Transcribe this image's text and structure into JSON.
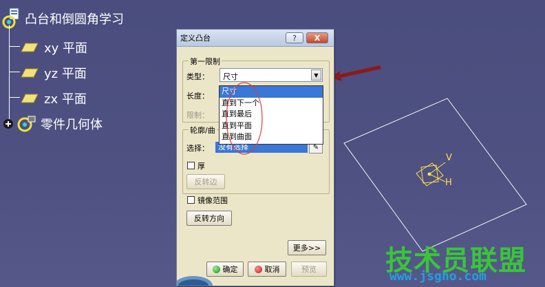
{
  "tree": {
    "root": {
      "label": "凸台和倒圆角学习",
      "icon": "part-icon"
    },
    "children": [
      {
        "label": "xy 平面",
        "icon": "plane-icon"
      },
      {
        "label": "yz 平面",
        "icon": "plane-icon"
      },
      {
        "label": "zx 平面",
        "icon": "plane-icon"
      },
      {
        "label": "零件几何体",
        "icon": "body-icon"
      }
    ]
  },
  "dialog": {
    "title": "定义凸台",
    "help_label": "?",
    "close_label": "X",
    "first_limit": {
      "group_title": "第一限制",
      "type_label": "类型：",
      "type_value": "尺寸",
      "length_label": "长度：",
      "limit_label": "限制："
    },
    "dropdown_options": [
      "尺寸",
      "直到下一个",
      "直到最后",
      "直到平面",
      "直到曲面"
    ],
    "profile": {
      "group_title": "轮廓/曲",
      "select_label": "选择：",
      "select_value": "没有选择",
      "thick_label": "厚",
      "reverse_side_label": "反转边"
    },
    "mirror_label": "镜像范围",
    "reverse_dir_label": "反转方向",
    "more_label": "更多>>",
    "ok_label": "确定",
    "cancel_label": "取消",
    "preview_label": "预览"
  },
  "axis_labels": {
    "v": "V",
    "h": "H"
  },
  "watermark": {
    "main": "技术员联盟",
    "url": "www.jsgho.com"
  },
  "colors": {
    "background": "#4e5181",
    "dialog": "#ece6c9",
    "selection": "#3a77d6",
    "arrow": "#8b1a1a",
    "annotation_circle": "#e03b3b",
    "axis": "#ffe14a",
    "watermark_green": "#39c53a",
    "watermark_blue": "#1fa2e0"
  }
}
